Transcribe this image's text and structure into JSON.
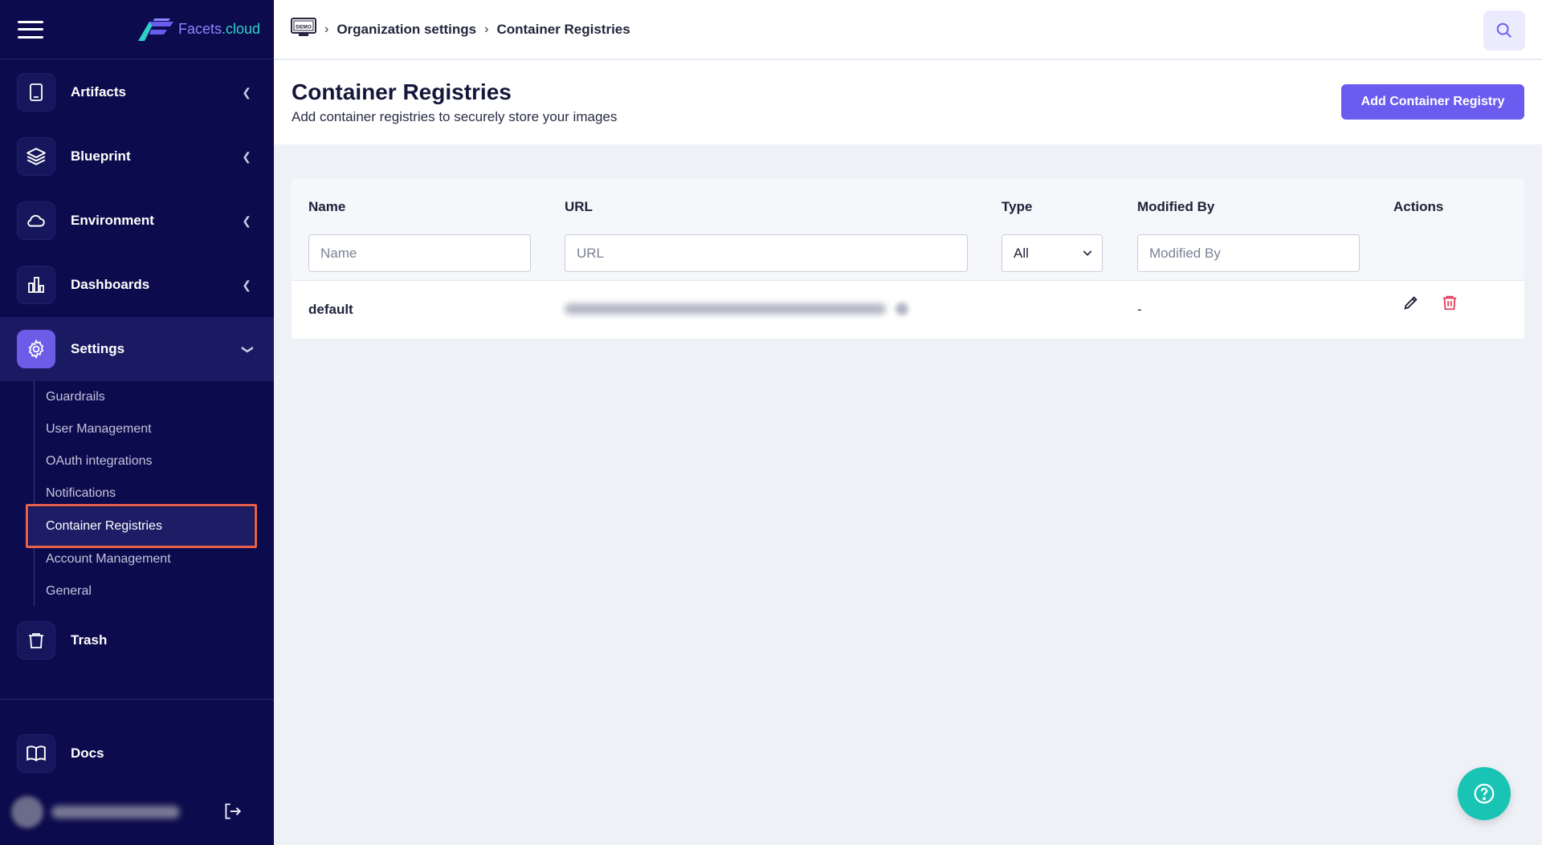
{
  "app": {
    "logo_text_a": "Facets",
    "logo_text_b": ".cloud"
  },
  "sidebar": {
    "items": [
      {
        "label": "Artifacts",
        "icon": "tablet-icon"
      },
      {
        "label": "Blueprint",
        "icon": "layers-icon"
      },
      {
        "label": "Environment",
        "icon": "cloud-icon"
      },
      {
        "label": "Dashboards",
        "icon": "bar-chart-icon"
      },
      {
        "label": "Settings",
        "icon": "gear-icon"
      },
      {
        "label": "Trash",
        "icon": "trash-icon"
      },
      {
        "label": "Docs",
        "icon": "book-icon"
      }
    ],
    "settings_sub": [
      "Guardrails",
      "User Management",
      "OAuth integrations",
      "Notifications",
      "Container Registries",
      "Account Management",
      "General"
    ],
    "active_sub": "Container Registries"
  },
  "header": {
    "badge": "DEMO",
    "breadcrumb": [
      "Organization settings",
      "Container Registries"
    ]
  },
  "page": {
    "title": "Container Registries",
    "subtitle": "Add container registries to securely store your images",
    "add_button": "Add Container Registry"
  },
  "table": {
    "columns": [
      "Name",
      "URL",
      "Type",
      "Modified By",
      "Actions"
    ],
    "filters": {
      "name_placeholder": "Name",
      "url_placeholder": "URL",
      "type_selected": "All",
      "modified_placeholder": "Modified By"
    },
    "rows": [
      {
        "name": "default",
        "type": "",
        "modified_by": "-"
      }
    ]
  },
  "colors": {
    "sidebar_bg": "#0b0b4d",
    "accent": "#6b5cf0",
    "help_button": "#19c4b5",
    "highlight": "#e8614b",
    "delete_icon": "#e0405e"
  }
}
